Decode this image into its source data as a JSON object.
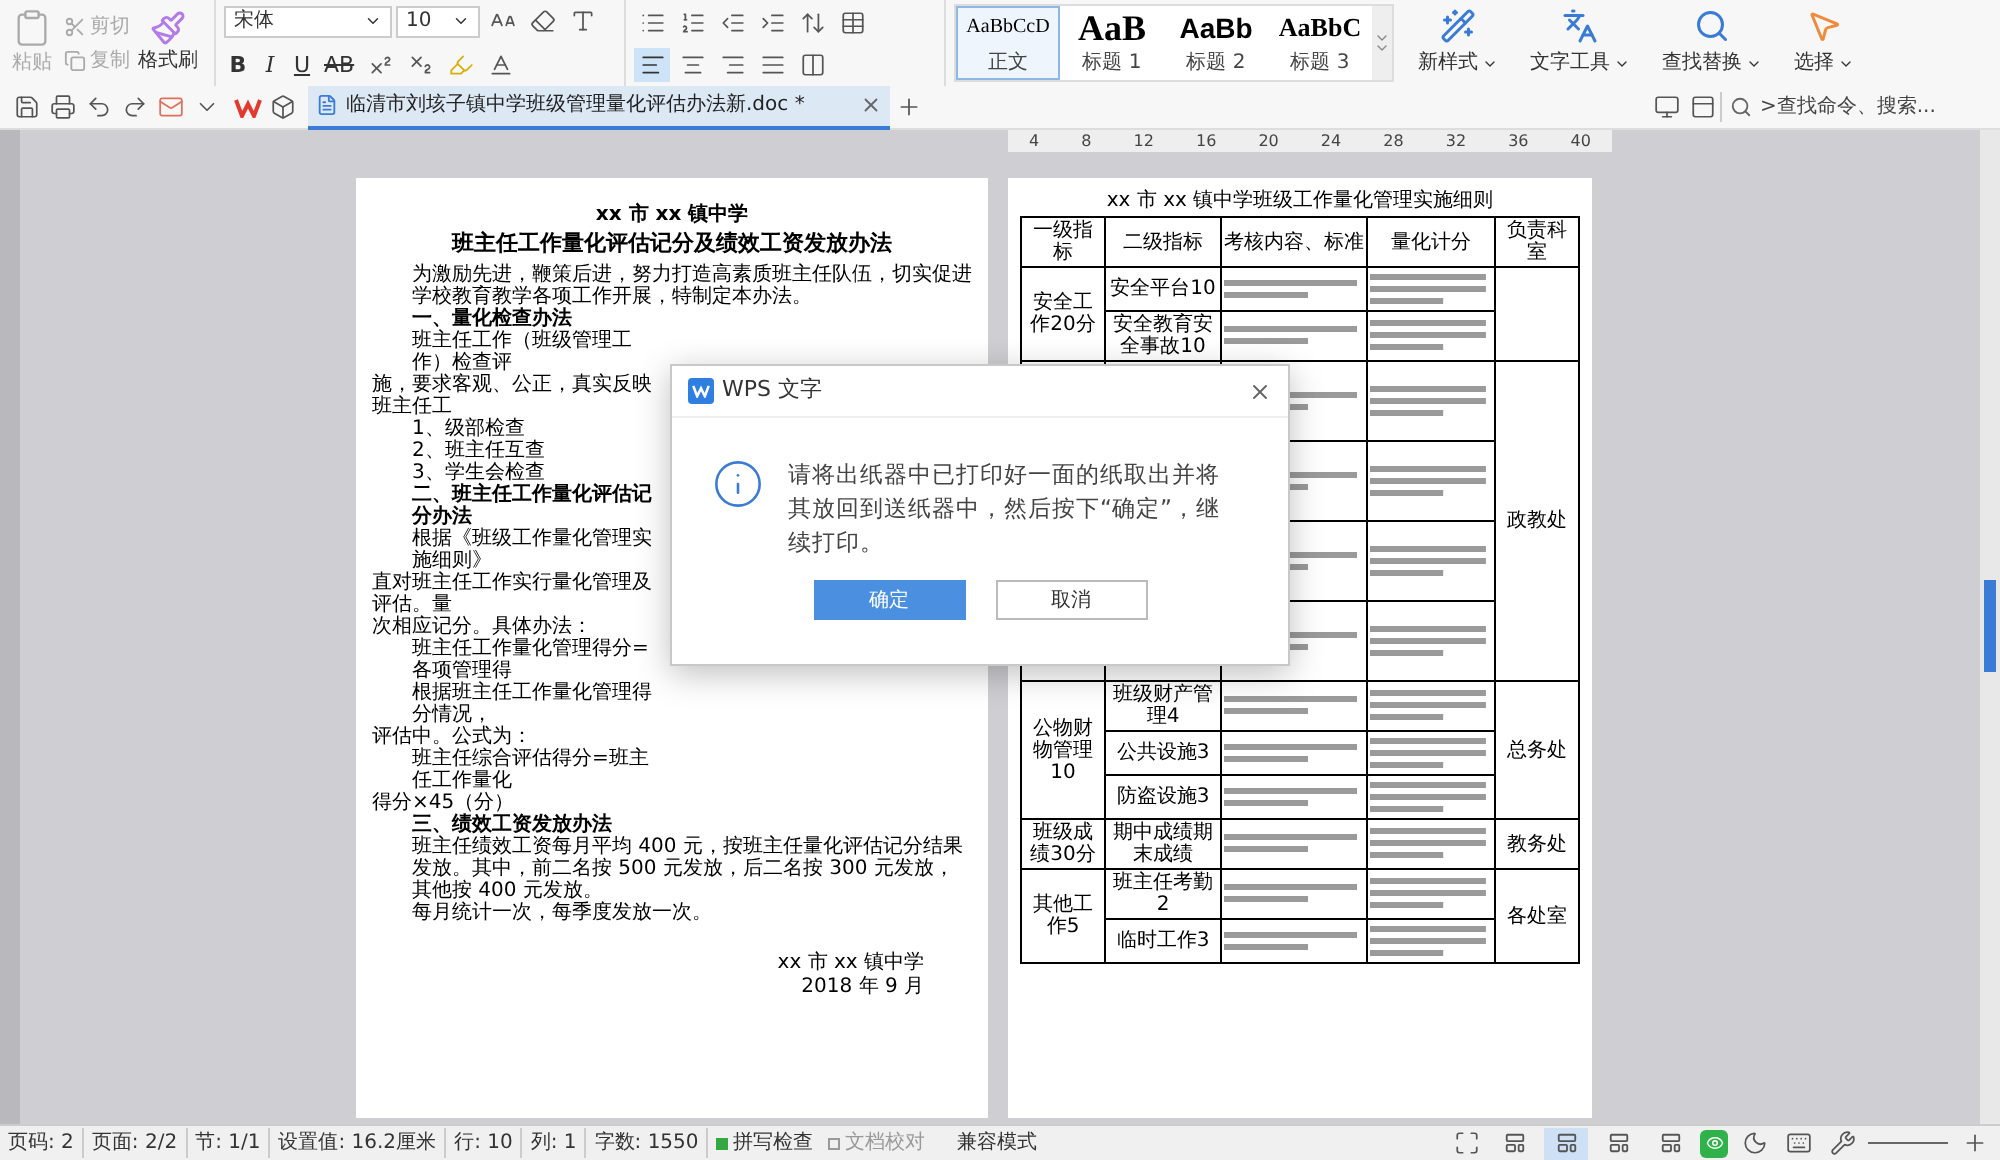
{
  "ribbon": {
    "clipboard": [
      {
        "label": "粘贴",
        "kind": "paste",
        "disabled": true
      },
      {
        "label": "剪切",
        "kind": "cut",
        "disabled": true
      },
      {
        "label": "复制",
        "kind": "copy",
        "disabled": true
      },
      {
        "label": "格式刷",
        "kind": "painter",
        "disabled": false
      }
    ],
    "font_name": "宋体",
    "font_size": "10",
    "format_buttons": [
      {
        "label": "B",
        "kind": "bold"
      },
      {
        "label": "I",
        "kind": "italic"
      },
      {
        "label": "U",
        "kind": "underline"
      },
      {
        "label": "AB",
        "kind": "strike"
      }
    ],
    "alignments": [
      {
        "selected": true
      },
      {
        "selected": false
      },
      {
        "selected": false
      },
      {
        "selected": false
      },
      {
        "selected": false
      }
    ],
    "styles": [
      {
        "preview": "AaBbCcD",
        "label": "正文",
        "kind": "body",
        "selected": true
      },
      {
        "preview": "AaB",
        "label": "标题 1",
        "kind": "h1",
        "selected": false
      },
      {
        "preview": "AaBb",
        "label": "标题 2",
        "kind": "h2",
        "selected": false
      },
      {
        "preview": "AaBbC",
        "label": "标题 3",
        "kind": "h3",
        "selected": false
      }
    ],
    "tools": [
      {
        "label": "新样式",
        "kind": "style"
      },
      {
        "label": "文字工具",
        "kind": "text"
      },
      {
        "label": "查找替换",
        "kind": "find"
      },
      {
        "label": "选择",
        "kind": "select"
      }
    ]
  },
  "tab_bar": {
    "document_tab": {
      "title": "临清市刘垓子镇中学班级管理量化评估办法新.doc *",
      "selected": true
    },
    "command_search": {
      "placeholder": ">查找命令、搜索..."
    }
  },
  "ruler": [
    "4",
    "8",
    "12",
    "16",
    "20",
    "24",
    "28",
    "32",
    "36",
    "40"
  ],
  "left_page": {
    "school": "xx 市 xx 镇中学",
    "title": "班主任工作量化评估记分及绩效工资发放办法",
    "top": [
      {
        "kind": "indent",
        "text": "为激励先进，鞭策后进，努力打造高素质班主任队伍，切实促进学校教育教学各项工作开展，特制定本办法。"
      },
      {
        "kind": "heading",
        "text": "一、量化检查办法"
      }
    ],
    "beside_dialog": [
      {
        "kind": "indent",
        "text": "班主任工作（班级管理工作）检查评"
      },
      {
        "kind": "flush",
        "text": "施，要求客观、公正，真实反映班主任工"
      },
      {
        "kind": "indent",
        "text": "1、级部检查"
      },
      {
        "kind": "indent",
        "text": "2、班主任互查"
      },
      {
        "kind": "indent",
        "text": "3、学生会检查"
      },
      {
        "kind": "heading",
        "text": "二、班主任工作量化评估记分办法"
      },
      {
        "kind": "indent",
        "text": "根据《班级工作量化管理实施细则》"
      },
      {
        "kind": "flush",
        "text": "直对班主任工作实行量化管理及评估。量"
      },
      {
        "kind": "flush",
        "text": "次相应记分。具体办法："
      },
      {
        "kind": "indent",
        "text": "班主任工作量化管理得分=各项管理得"
      },
      {
        "kind": "indent",
        "text": "根据班主任工作量化管理得分情况，"
      },
      {
        "kind": "flush",
        "text": "评估中。公式为："
      },
      {
        "kind": "indent",
        "text": "班主任综合评估得分=班主任工作量化"
      },
      {
        "kind": "flush",
        "text": "得分×45（分）"
      }
    ],
    "bottom": [
      {
        "kind": "heading",
        "text": "三、绩效工资发放办法"
      },
      {
        "kind": "indent",
        "text": "班主任绩效工资每月平均 400 元，按班主任量化评估记分结果发放。其中，前二名按 500 元发放，后二名按 300 元发放，其他按 400 元发放。"
      },
      {
        "kind": "indent",
        "text": "每月统计一次，每季度发放一次。"
      }
    ],
    "signature": [
      "xx 市 xx 镇中学",
      "2018 年 9 月"
    ]
  },
  "right_page": {
    "title": "xx 市 xx 镇中学班级工作量化管理实施细则",
    "columns": [
      "一级指标",
      "二级指标",
      "考核内容、标准",
      "量化计分",
      "负责科室"
    ],
    "groups": [
      {
        "level1": "安全工作20分",
        "items": [
          {
            "level2": "安全平台10"
          },
          {
            "level2": "安全教育安全事故10"
          }
        ]
      },
      {
        "items": [
          {
            "kind": "covered"
          },
          {
            "kind": "covered"
          },
          {
            "kind": "covered"
          },
          {
            "kind": "covered"
          }
        ],
        "dept": "政教处"
      },
      {
        "level1": "公物财物管理10",
        "items": [
          {
            "level2": "班级财产管理4"
          },
          {
            "level2": "公共设施3"
          },
          {
            "level2": "防盗设施3"
          }
        ],
        "dept": "总务处"
      },
      {
        "level1": "班级成绩30分",
        "items": [
          {
            "level2": "期中成绩期末成绩"
          }
        ],
        "dept": "教务处"
      },
      {
        "level1": "其他工作5",
        "items": [
          {
            "level2": "班主任考勤2"
          },
          {
            "level2": "临时工作3"
          }
        ],
        "dept": "各处室"
      }
    ]
  },
  "dialog": {
    "title": "WPS 文字",
    "message": "请将出纸器中已打印好一面的纸取出并将其放回到送纸器中，然后按下“确定”，继续打印。",
    "buttons": [
      {
        "label": "确定",
        "kind": "primary"
      },
      {
        "label": "取消",
        "kind": "secondary"
      }
    ]
  },
  "status_bar": {
    "fields": [
      "页码: 2",
      "页面: 2/2",
      "节: 1/1",
      "设置值: 16.2厘米",
      "行: 10",
      "列: 1",
      "字数: 1550"
    ],
    "checks": [
      {
        "label": "拼写检查",
        "checked": true
      },
      {
        "label": "文档校对",
        "checked": false
      }
    ],
    "mode": "兼容模式",
    "views": [
      {
        "selected": false
      },
      {
        "selected": true
      },
      {
        "selected": false
      },
      {
        "selected": false
      }
    ]
  }
}
